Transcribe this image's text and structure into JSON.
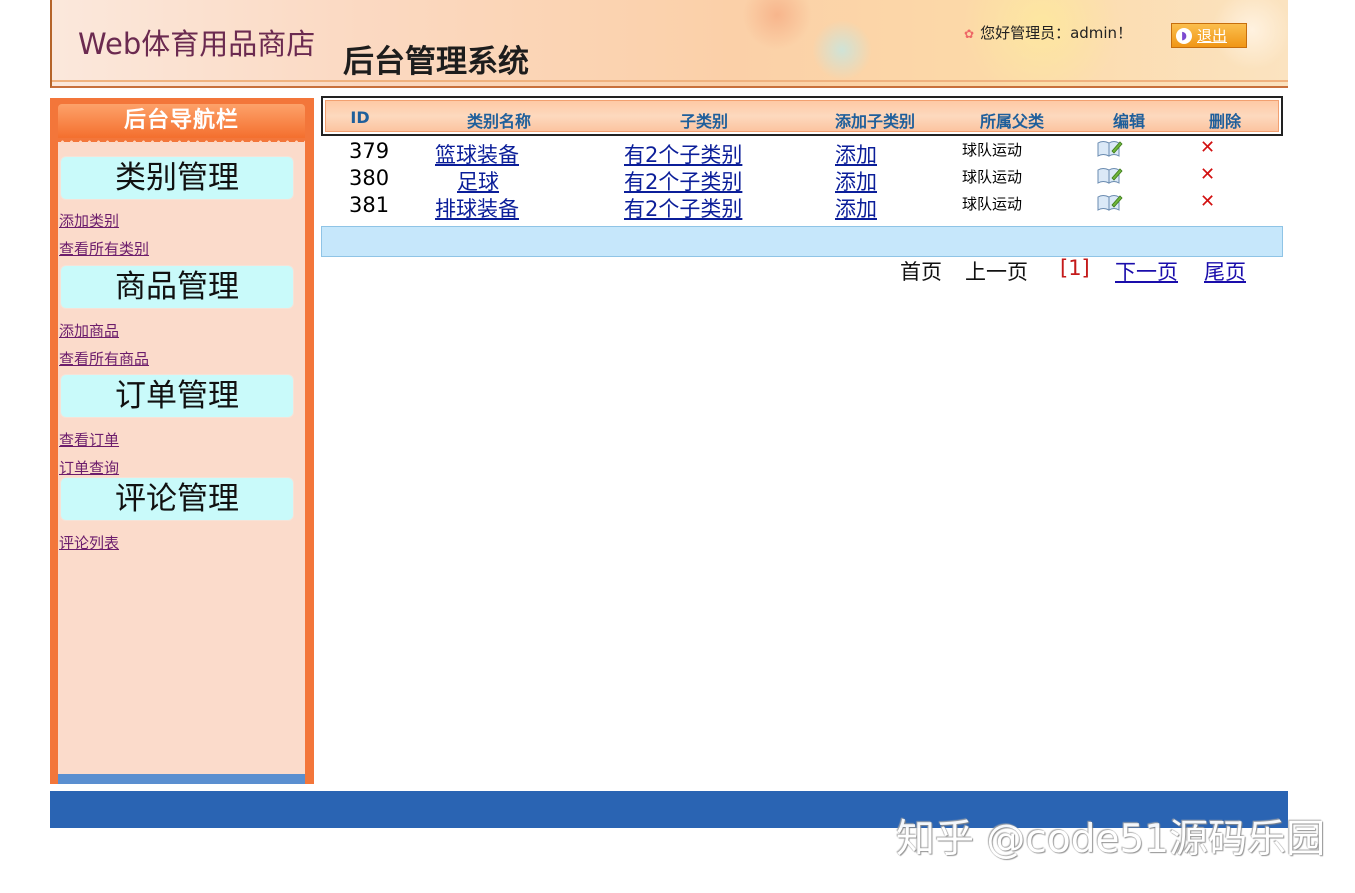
{
  "header": {
    "site_title": "Web体育用品商店",
    "system_title": "后台管理系统",
    "greeting": "您好管理员：admin！",
    "logout_label": "退出"
  },
  "sidebar": {
    "title": "后台导航栏",
    "sections": [
      {
        "title": "类别管理",
        "links": [
          "添加类别",
          "查看所有类别"
        ]
      },
      {
        "title": "商品管理",
        "links": [
          "添加商品",
          "查看所有商品"
        ]
      },
      {
        "title": "订单管理",
        "links": [
          "查看订单",
          "订单查询"
        ]
      },
      {
        "title": "评论管理",
        "links": [
          "评论列表"
        ]
      }
    ]
  },
  "table": {
    "columns": [
      "ID",
      "类别名称",
      "子类别",
      "添加子类别",
      "所属父类",
      "编辑",
      "删除"
    ],
    "rows": [
      {
        "id": "379",
        "name": "篮球装备",
        "subcategory": "有2个子类别",
        "add": "添加",
        "parent": "球队运动",
        "edit_icon": "edit-icon",
        "delete_icon": "delete-icon"
      },
      {
        "id": "380",
        "name": "足球",
        "subcategory": "有2个子类别",
        "add": "添加",
        "parent": "球队运动",
        "edit_icon": "edit-icon",
        "delete_icon": "delete-icon"
      },
      {
        "id": "381",
        "name": "排球装备",
        "subcategory": "有2个子类别",
        "add": "添加",
        "parent": "球队运动",
        "edit_icon": "edit-icon",
        "delete_icon": "delete-icon"
      }
    ]
  },
  "pagination": {
    "first": "首页",
    "prev": "上一页",
    "current": "[1]",
    "next": "下一页",
    "last": "尾页"
  },
  "watermark": "知乎 @code51源码乐园",
  "colors": {
    "sidebar_orange": "#f3763a",
    "section_head": "#c9fafa",
    "footer_blue": "#2a64b3",
    "header_text": "#1f5f9b"
  }
}
